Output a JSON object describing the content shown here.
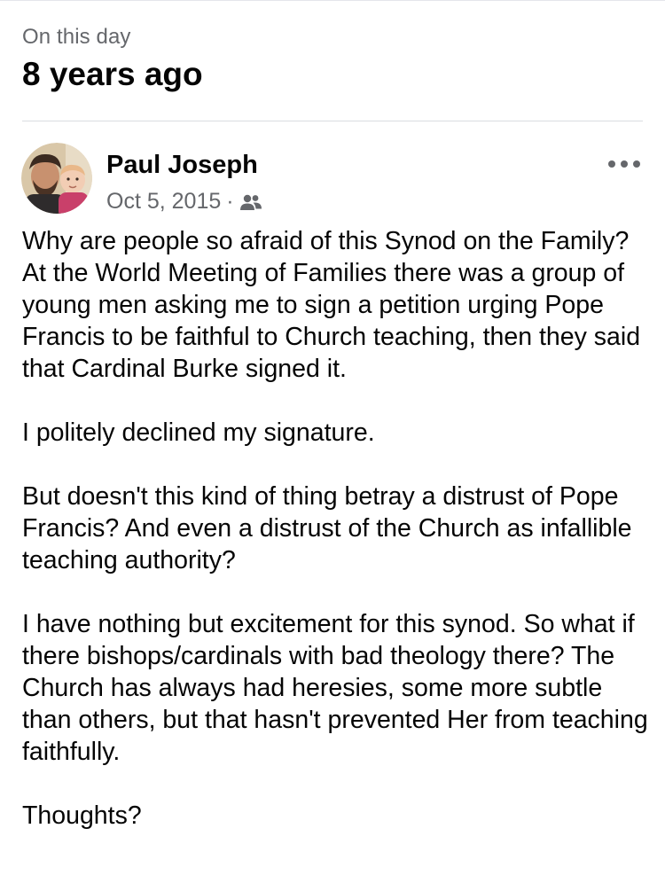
{
  "memory": {
    "eyebrow": "On this day",
    "headline": "8 years ago"
  },
  "post": {
    "author": "Paul Joseph",
    "date": "Oct 5, 2015",
    "separator": "·",
    "audience_icon": "friends-icon",
    "more_icon": "more-options-icon",
    "paragraphs": [
      "Why are people so afraid of this Synod on the Family? At the World Meeting of Families there was a group of young men asking me to sign a petition urging Pope Francis to be faithful to Church teaching, then they said that Cardinal Burke signed it.",
      "I politely declined my signature.",
      "But doesn't this kind of thing betray a distrust of Pope Francis? And even a distrust of the Church as infallible teaching authority?",
      "I have nothing but excitement for this synod. So what if there bishops/cardinals with bad theology there? The Church has always had heresies, some more subtle than others, but that hasn't prevented Her from teaching faithfully.",
      "Thoughts?"
    ]
  },
  "colors": {
    "primary_text": "#050505",
    "secondary_text": "#65676b",
    "divider": "#dadde1",
    "background": "#ffffff"
  }
}
